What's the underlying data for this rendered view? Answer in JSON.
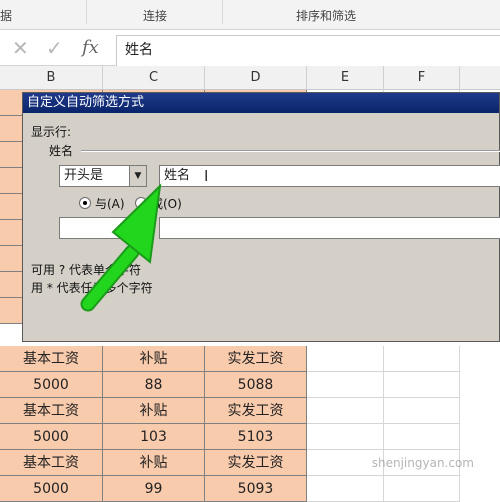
{
  "ribbon": {
    "groups": [
      "据",
      "连接",
      "排序和筛选"
    ]
  },
  "formula_bar": {
    "cancel_icon": "close-icon",
    "confirm_icon": "check-icon",
    "fx_label": "fx",
    "value": "姓名"
  },
  "columns": [
    "B",
    "C",
    "D",
    "E",
    "F"
  ],
  "sheet_rows": [
    [
      "基本工资",
      "补贴",
      "实发工资"
    ],
    [
      "5000",
      "88",
      "5088"
    ],
    [
      "基本工资",
      "补贴",
      "实发工资"
    ],
    [
      "5000",
      "103",
      "5103"
    ],
    [
      "基本工资",
      "补贴",
      "实发工资"
    ],
    [
      "5000",
      "99",
      "5093"
    ]
  ],
  "dialog": {
    "title": "自定义自动筛选方式",
    "show_rows_label": "显示行:",
    "field_label": "姓名",
    "condition1": {
      "operator": "开头是",
      "value": "姓名"
    },
    "and_label": "与(A)",
    "or_label": "或(O)",
    "logic_selected": "and",
    "condition2": {
      "operator": "",
      "value": ""
    },
    "hint1": "可用 ? 代表单个字符",
    "hint2": "用 * 代表任意多个字符"
  },
  "colors": {
    "header_fill": "#f8cbad",
    "arrow": "#22d61e",
    "title_bar": "#0a246a"
  },
  "watermark": "shenjingyan.com"
}
